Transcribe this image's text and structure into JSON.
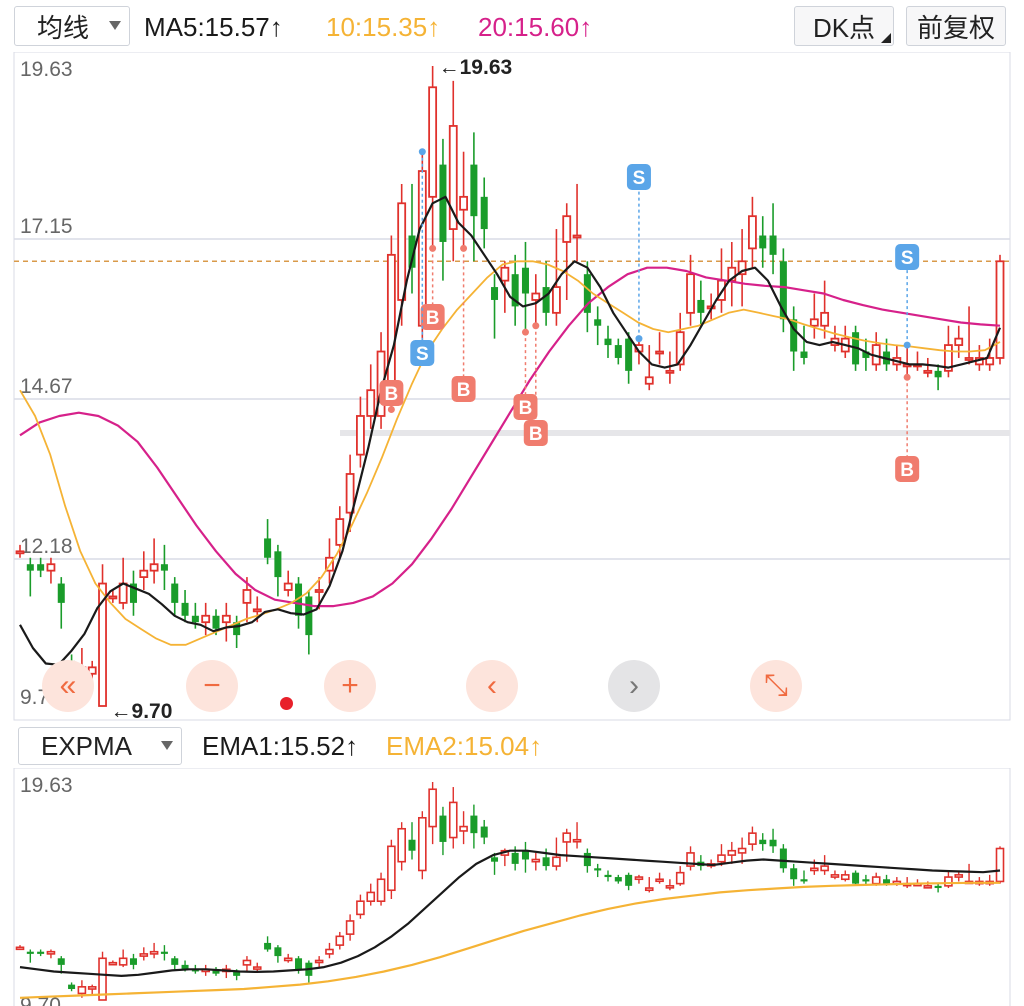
{
  "toolbar": {
    "indicator_select": "均线",
    "ma5": "MA5:15.57↑",
    "ma10": "10:15.35↑",
    "ma20": "20:15.60↑",
    "dk_button": "DK点",
    "fq_button": "前复权"
  },
  "colors": {
    "up": "#e0312c",
    "down": "#1a9c2a",
    "ma5": "#1a1a1a",
    "ma10": "#f5b335",
    "ma20": "#d6218a",
    "buy_marker": "#f07c6e",
    "sell_marker": "#5aa5e8",
    "grid": "#d9dbe6",
    "ref_line": "#d99a4a",
    "ctrl_bg": "#fde4dc",
    "ctrl_fg": "#f06a40"
  },
  "main_chart": {
    "price_ticks": [
      "19.63",
      "17.15",
      "14.67",
      "12.18",
      "9.70"
    ],
    "high_label": "←19.63",
    "low_label": "←9.70",
    "ylim": [
      9.7,
      19.63
    ]
  },
  "markers": [
    {
      "label": "B",
      "type": "buy"
    },
    {
      "label": "B",
      "type": "buy"
    },
    {
      "label": "B",
      "type": "buy"
    },
    {
      "label": "B",
      "type": "buy"
    },
    {
      "label": "B",
      "type": "buy"
    },
    {
      "label": "B",
      "type": "buy"
    },
    {
      "label": "S",
      "type": "sell"
    },
    {
      "label": "S",
      "type": "sell"
    },
    {
      "label": "S",
      "type": "sell"
    }
  ],
  "controls": [
    {
      "name": "scroll-left-fast-button",
      "icon": "double-chevron-left-icon",
      "glyph": "«"
    },
    {
      "name": "zoom-out-button",
      "icon": "minus-icon",
      "glyph": "−"
    },
    {
      "name": "zoom-in-button",
      "icon": "plus-icon",
      "glyph": "+"
    },
    {
      "name": "scroll-left-button",
      "icon": "chevron-left-icon",
      "glyph": "‹"
    },
    {
      "name": "scroll-right-button",
      "icon": "chevron-right-icon",
      "glyph": "›"
    },
    {
      "name": "fullscreen-button",
      "icon": "expand-icon",
      "glyph": "⤡"
    }
  ],
  "sub_indicator": {
    "select": "EXPMA",
    "ema1": "EMA1:15.52↑",
    "ema2": "EMA2:15.04↑",
    "ema1_color": "#1a1a1a",
    "ema2_color": "#f5b335",
    "price_ticks": [
      "19.63",
      "9.70"
    ]
  },
  "chart_data": {
    "type": "candlestick",
    "ylim": [
      9.7,
      19.63
    ],
    "series_ohlc": [
      [
        12.1,
        12.1,
        12.2,
        12.0
      ],
      [
        11.9,
        11.8,
        12.0,
        11.4
      ],
      [
        11.9,
        11.8,
        12.0,
        11.7
      ],
      [
        11.8,
        11.9,
        12.0,
        11.6
      ],
      [
        11.6,
        11.3,
        11.7,
        10.9
      ],
      [
        10.4,
        10.2,
        10.5,
        10.1
      ],
      [
        10.0,
        10.3,
        10.6,
        9.8
      ],
      [
        10.2,
        10.3,
        10.4,
        9.9
      ],
      [
        9.7,
        11.6,
        11.9,
        9.7
      ],
      [
        11.4,
        11.4,
        11.5,
        11.3
      ],
      [
        11.3,
        11.6,
        12.0,
        11.2
      ],
      [
        11.6,
        11.3,
        11.8,
        11.1
      ],
      [
        11.7,
        11.8,
        12.1,
        11.5
      ],
      [
        11.8,
        11.9,
        12.3,
        11.6
      ],
      [
        11.9,
        11.8,
        12.2,
        11.5
      ],
      [
        11.6,
        11.3,
        11.7,
        11.1
      ],
      [
        11.3,
        11.1,
        11.5,
        11.0
      ],
      [
        11.1,
        11.0,
        11.3,
        10.9
      ],
      [
        11.0,
        11.1,
        11.3,
        10.8
      ],
      [
        11.1,
        10.9,
        11.2,
        10.8
      ],
      [
        11.0,
        11.1,
        11.3,
        10.7
      ],
      [
        11.0,
        10.8,
        11.1,
        10.6
      ],
      [
        11.3,
        11.5,
        11.7,
        11.0
      ],
      [
        11.2,
        11.2,
        11.4,
        11.0
      ],
      [
        12.3,
        12.0,
        12.6,
        11.9
      ],
      [
        12.1,
        11.7,
        12.2,
        11.4
      ],
      [
        11.5,
        11.6,
        11.8,
        11.4
      ],
      [
        11.6,
        11.1,
        11.7,
        10.9
      ],
      [
        11.4,
        10.8,
        11.5,
        10.5
      ],
      [
        11.5,
        11.5,
        11.7,
        11.2
      ],
      [
        11.8,
        12.0,
        12.3,
        11.6
      ],
      [
        12.2,
        12.6,
        12.8,
        12.0
      ],
      [
        12.7,
        13.3,
        13.6,
        12.4
      ],
      [
        13.6,
        14.2,
        14.5,
        13.4
      ],
      [
        14.2,
        14.6,
        15.0,
        14.0
      ],
      [
        14.2,
        15.2,
        15.5,
        14.0
      ],
      [
        14.7,
        16.7,
        17.0,
        14.3
      ],
      [
        16.0,
        17.5,
        17.8,
        15.6
      ],
      [
        17.0,
        16.5,
        17.8,
        16.1
      ],
      [
        15.6,
        18.0,
        18.3,
        15.2
      ],
      [
        17.6,
        19.3,
        19.63,
        16.8
      ],
      [
        18.1,
        16.9,
        18.5,
        16.3
      ],
      [
        17.1,
        18.7,
        19.4,
        16.6
      ],
      [
        17.4,
        17.6,
        18.3,
        16.8
      ],
      [
        18.1,
        17.3,
        18.6,
        16.6
      ],
      [
        17.6,
        17.1,
        17.9,
        16.8
      ],
      [
        16.2,
        16.0,
        16.4,
        15.4
      ],
      [
        16.3,
        16.5,
        16.6,
        15.8
      ],
      [
        16.4,
        15.9,
        16.7,
        15.6
      ],
      [
        16.5,
        16.1,
        16.9,
        15.5
      ],
      [
        16.0,
        16.1,
        16.4,
        15.6
      ],
      [
        16.2,
        15.8,
        16.6,
        15.6
      ],
      [
        15.8,
        16.2,
        17.1,
        15.6
      ],
      [
        16.9,
        17.3,
        17.5,
        16.0
      ],
      [
        17.0,
        17.0,
        17.8,
        16.6
      ],
      [
        16.4,
        15.8,
        16.6,
        15.5
      ],
      [
        15.7,
        15.6,
        15.9,
        15.3
      ],
      [
        15.4,
        15.3,
        15.6,
        15.1
      ],
      [
        15.3,
        15.1,
        15.4,
        15.0
      ],
      [
        15.4,
        14.9,
        15.5,
        14.7
      ],
      [
        15.2,
        15.3,
        15.4,
        15.0
      ],
      [
        14.7,
        14.8,
        15.3,
        14.6
      ],
      [
        15.2,
        15.2,
        15.5,
        15.0
      ],
      [
        14.9,
        14.9,
        15.2,
        14.7
      ],
      [
        15.0,
        15.5,
        15.8,
        14.9
      ],
      [
        15.8,
        16.4,
        16.7,
        15.6
      ],
      [
        16.0,
        15.8,
        16.3,
        15.6
      ],
      [
        15.9,
        15.9,
        16.1,
        15.7
      ],
      [
        16.0,
        16.3,
        16.8,
        15.8
      ],
      [
        16.3,
        16.5,
        16.9,
        15.9
      ],
      [
        16.4,
        16.6,
        17.1,
        15.9
      ],
      [
        16.8,
        17.3,
        17.6,
        16.5
      ],
      [
        17.0,
        16.8,
        17.3,
        16.5
      ],
      [
        17.0,
        16.7,
        17.5,
        16.4
      ],
      [
        16.6,
        15.7,
        16.8,
        15.5
      ],
      [
        15.7,
        15.2,
        15.9,
        14.9
      ],
      [
        15.2,
        15.1,
        15.6,
        15.0
      ],
      [
        15.6,
        15.7,
        16.1,
        15.4
      ],
      [
        15.6,
        15.8,
        16.3,
        15.4
      ],
      [
        15.3,
        15.4,
        15.6,
        15.2
      ],
      [
        15.2,
        15.4,
        15.6,
        15.1
      ],
      [
        15.5,
        15.0,
        15.6,
        14.9
      ],
      [
        15.2,
        15.1,
        15.4,
        14.9
      ],
      [
        15.0,
        15.3,
        15.5,
        14.9
      ],
      [
        15.2,
        15.0,
        15.4,
        14.9
      ],
      [
        15.0,
        15.1,
        15.3,
        14.9
      ],
      [
        15.0,
        15.0,
        15.3,
        14.8
      ],
      [
        15.0,
        15.0,
        15.2,
        14.9
      ],
      [
        14.9,
        14.9,
        15.1,
        14.8
      ],
      [
        14.9,
        14.8,
        15.0,
        14.6
      ],
      [
        14.9,
        15.3,
        15.6,
        14.8
      ],
      [
        15.3,
        15.4,
        15.6,
        15.1
      ],
      [
        15.1,
        15.1,
        15.9,
        15.0
      ],
      [
        15.0,
        15.1,
        15.3,
        14.9
      ],
      [
        15.0,
        15.1,
        15.4,
        14.9
      ],
      [
        15.1,
        16.6,
        16.7,
        15.0
      ]
    ],
    "ma5": [
      10.96,
      10.6,
      10.36,
      10.34,
      10.56,
      10.82,
      11.22,
      11.48,
      11.6,
      11.52,
      11.44,
      11.28,
      11.1,
      11.0,
      10.96,
      10.86,
      10.92,
      10.94,
      11.0,
      11.16,
      11.2,
      11.14,
      11.12,
      11.2,
      11.56,
      12.1,
      12.9,
      13.7,
      14.6,
      15.3,
      16.3,
      17.1,
      17.5,
      17.6,
      17.2,
      17.0,
      16.7,
      16.4,
      16.05,
      15.9,
      15.95,
      16.1,
      16.4,
      16.6,
      16.5,
      16.2,
      15.8,
      15.5,
      15.2,
      15.0,
      14.95,
      15.0,
      15.3,
      15.65,
      16.0,
      16.3,
      16.45,
      16.5,
      16.3,
      15.9,
      15.55,
      15.35,
      15.3,
      15.35,
      15.3,
      15.25,
      15.15,
      15.1,
      15.05,
      15.0,
      15.0,
      14.98,
      14.95,
      15.0,
      15.05,
      15.1,
      15.57
    ],
    "ma10": [
      14.6,
      14.2,
      13.6,
      12.8,
      12.1,
      11.6,
      11.3,
      11.05,
      10.9,
      10.75,
      10.65,
      10.65,
      10.75,
      10.85,
      10.95,
      11.05,
      11.12,
      11.2,
      11.3,
      11.45,
      11.7,
      12.05,
      12.5,
      13.0,
      13.55,
      14.15,
      14.7,
      15.2,
      15.55,
      15.85,
      16.1,
      16.35,
      16.55,
      16.6,
      16.6,
      16.55,
      16.45,
      16.3,
      16.1,
      15.95,
      15.8,
      15.65,
      15.55,
      15.5,
      15.55,
      15.6,
      15.7,
      15.8,
      15.85,
      15.8,
      15.75,
      15.7,
      15.62,
      15.55,
      15.48,
      15.42,
      15.37,
      15.33,
      15.3,
      15.28,
      15.25,
      15.22,
      15.2,
      15.2,
      15.22,
      15.35
    ],
    "ma20": [
      13.9,
      14.1,
      14.2,
      14.25,
      14.2,
      14.05,
      13.8,
      13.4,
      12.95,
      12.5,
      12.1,
      11.75,
      11.5,
      11.35,
      11.3,
      11.25,
      11.25,
      11.3,
      11.4,
      11.6,
      11.9,
      12.3,
      12.75,
      13.25,
      13.75,
      14.25,
      14.75,
      15.2,
      15.6,
      15.95,
      16.2,
      16.4,
      16.5,
      16.5,
      16.45,
      16.35,
      16.3,
      16.25,
      16.22,
      16.2,
      16.15,
      16.1,
      16.0,
      15.92,
      15.85,
      15.8,
      15.75,
      15.7,
      15.65,
      15.62,
      15.6
    ],
    "ema1": [
      11.2,
      11.1,
      11.0,
      10.95,
      10.9,
      10.85,
      10.8,
      10.85,
      10.95,
      11.05,
      11.1,
      11.1,
      11.05,
      11.0,
      10.98,
      11.0,
      11.05,
      11.1,
      11.2,
      11.4,
      11.7,
      12.1,
      12.6,
      13.2,
      13.9,
      14.6,
      15.3,
      15.9,
      16.3,
      16.5,
      16.5,
      16.4,
      16.3,
      16.25,
      16.2,
      16.15,
      16.1,
      16.05,
      16.0,
      15.95,
      15.9,
      15.85,
      15.95,
      16.05,
      16.1,
      16.05,
      16.0,
      15.95,
      15.9,
      15.85,
      15.8,
      15.75,
      15.7,
      15.65,
      15.6,
      15.57,
      15.55,
      15.52,
      15.6
    ],
    "ema2": [
      9.8,
      9.85,
      9.9,
      9.95,
      10.0,
      10.05,
      10.1,
      10.15,
      10.2,
      10.3,
      10.4,
      10.55,
      10.75,
      11.0,
      11.3,
      11.65,
      12.05,
      12.45,
      12.85,
      13.2,
      13.55,
      13.85,
      14.1,
      14.3,
      14.45,
      14.6,
      14.7,
      14.78,
      14.85,
      14.9,
      14.94,
      14.97,
      15.0,
      15.02,
      15.04,
      15.04
    ]
  }
}
